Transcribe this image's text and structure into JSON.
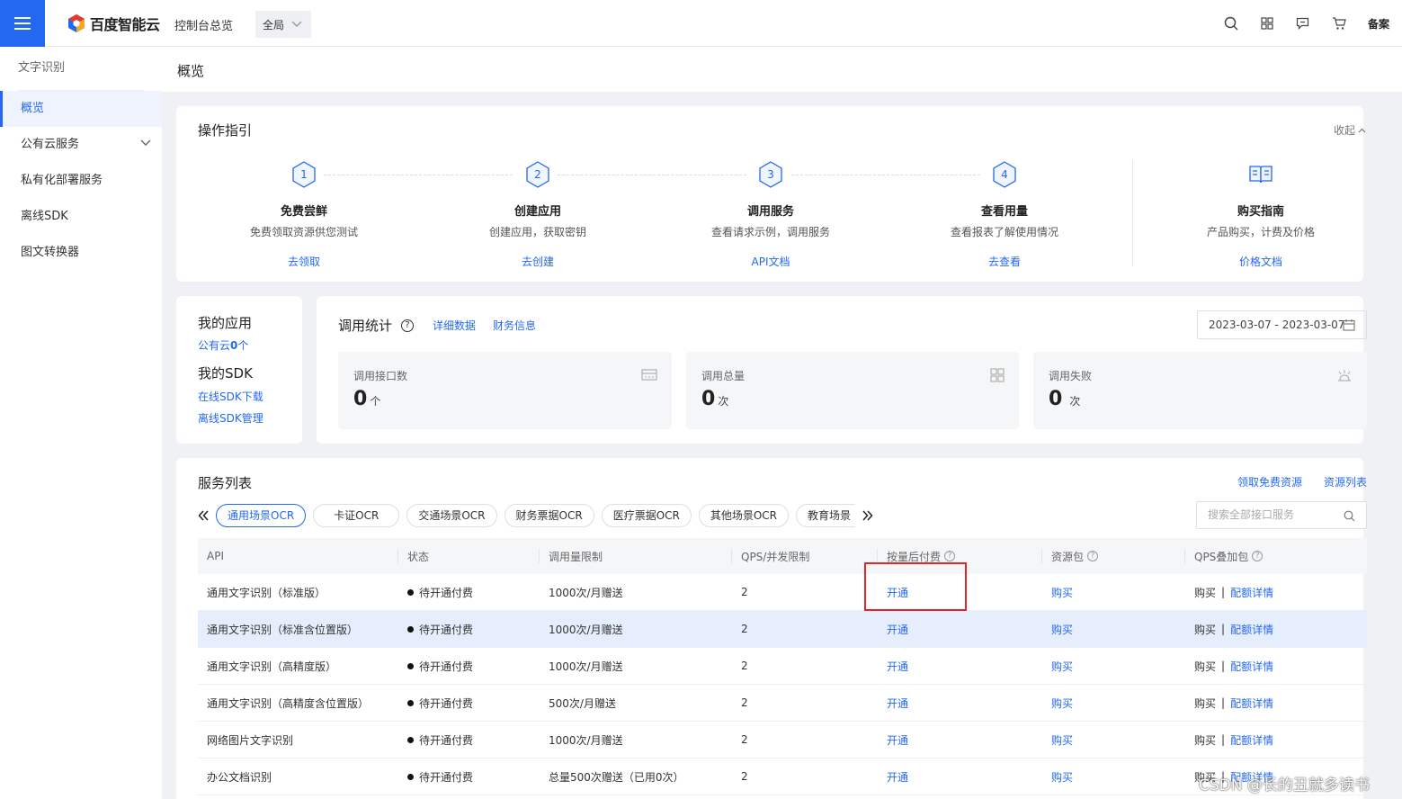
{
  "topbar": {
    "brand": "百度智能云",
    "console_overview": "控制台总览",
    "region": "全局",
    "beian": "备案"
  },
  "sidebar": {
    "title": "文字识别",
    "items": [
      {
        "label": "概览",
        "active": true
      },
      {
        "label": "公有云服务",
        "expandable": true
      },
      {
        "label": "私有化部署服务"
      },
      {
        "label": "离线SDK"
      },
      {
        "label": "图文转换器"
      }
    ]
  },
  "page": {
    "title": "概览"
  },
  "guide": {
    "title": "操作指引",
    "collapse": "收起",
    "steps": [
      {
        "num": "1",
        "title": "免费尝鲜",
        "desc": "免费领取资源供您测试",
        "link": "去领取"
      },
      {
        "num": "2",
        "title": "创建应用",
        "desc": "创建应用，获取密钥",
        "link": "去创建"
      },
      {
        "num": "3",
        "title": "调用服务",
        "desc": "查看请求示例，调用服务",
        "link": "API文档"
      },
      {
        "num": "4",
        "title": "查看用量",
        "desc": "查看报表了解使用情况",
        "link": "去查看"
      }
    ],
    "buy_guide": {
      "title": "购买指南",
      "desc": "产品购买，计费及价格",
      "link": "价格文档"
    }
  },
  "my_apps": {
    "title": "我的应用",
    "public_cloud_prefix": "公有云",
    "public_cloud_count": "0",
    "public_cloud_suffix": "个",
    "sdk_title": "我的SDK",
    "online_sdk": "在线SDK下载",
    "offline_sdk": "离线SDK管理"
  },
  "stats": {
    "title": "调用统计",
    "detail_link": "详细数据",
    "finance_link": "财务信息",
    "date_range": "2023-03-07 - 2023-03-07",
    "cards": [
      {
        "label": "调用接口数",
        "value": "0",
        "unit": "个",
        "icon": "chart-icon"
      },
      {
        "label": "调用总量",
        "value": "0",
        "unit": "次",
        "icon": "grid-icon"
      },
      {
        "label": "调用失败",
        "value": "0",
        "unit": "次",
        "icon": "warning-icon"
      }
    ]
  },
  "services": {
    "title": "服务列表",
    "free_link": "领取免费资源",
    "resource_link": "资源列表",
    "tabs": [
      "通用场景OCR",
      "卡证OCR",
      "交通场景OCR",
      "财务票据OCR",
      "医疗票据OCR",
      "其他场景OCR",
      "教育场景"
    ],
    "search_placeholder": "搜索全部接口服务",
    "columns": [
      "API",
      "状态",
      "调用量限制",
      "QPS/并发限制",
      "按量后付费",
      "资源包",
      "QPS叠加包"
    ],
    "rows": [
      {
        "api": "通用文字识别（标准版）",
        "status": "待开通付费",
        "limit": "1000次/月赠送",
        "qps": "2",
        "postpay": "开通",
        "pack": "购买",
        "qps_buy": "购买",
        "qps_detail": "配额详情"
      },
      {
        "api": "通用文字识别（标准含位置版）",
        "status": "待开通付费",
        "limit": "1000次/月赠送",
        "qps": "2",
        "postpay": "开通",
        "pack": "购买",
        "qps_buy": "购买",
        "qps_detail": "配额详情"
      },
      {
        "api": "通用文字识别（高精度版）",
        "status": "待开通付费",
        "limit": "1000次/月赠送",
        "qps": "2",
        "postpay": "开通",
        "pack": "购买",
        "qps_buy": "购买",
        "qps_detail": "配额详情"
      },
      {
        "api": "通用文字识别（高精度含位置版）",
        "status": "待开通付费",
        "limit": "500次/月赠送",
        "qps": "2",
        "postpay": "开通",
        "pack": "购买",
        "qps_buy": "购买",
        "qps_detail": "配额详情"
      },
      {
        "api": "网络图片文字识别",
        "status": "待开通付费",
        "limit": "1000次/月赠送",
        "qps": "2",
        "postpay": "开通",
        "pack": "购买",
        "qps_buy": "购买",
        "qps_detail": "配额详情"
      },
      {
        "api": "办公文档识别",
        "status": "待开通付费",
        "limit": "总量500次赠送（已用0次）",
        "qps": "2",
        "postpay": "开通",
        "pack": "购买",
        "qps_buy": "购买",
        "qps_detail": "配额详情"
      }
    ]
  },
  "watermark": "CSDN @长的丑就多读书",
  "colors": {
    "accent": "#2468f2",
    "highlight": "#e3242b"
  }
}
